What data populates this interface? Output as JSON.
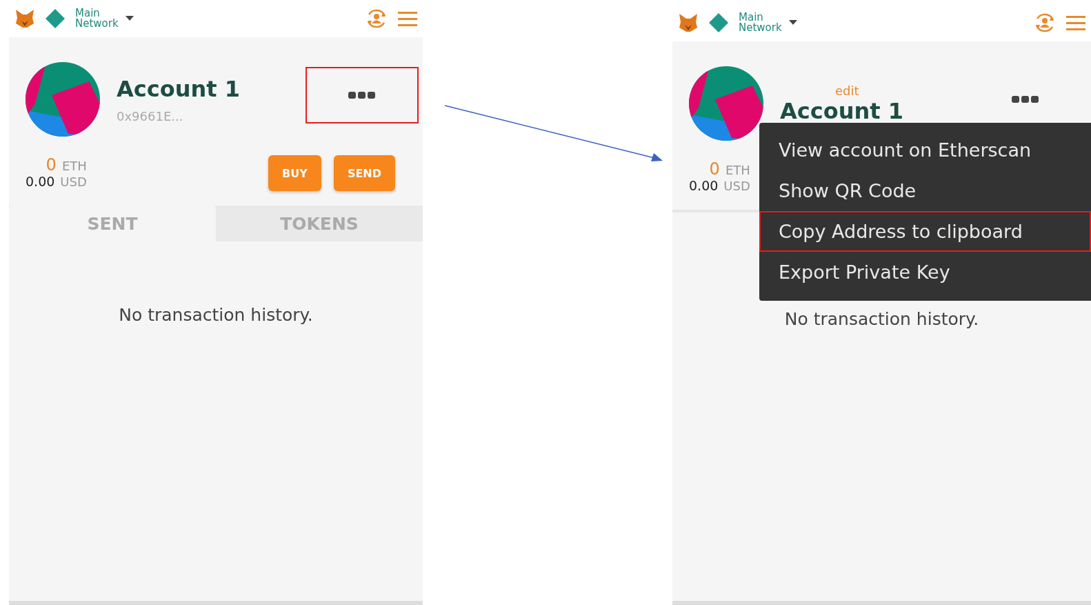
{
  "panels": [
    {
      "network": {
        "line1": "Main",
        "line2": "Network"
      },
      "account": {
        "name": "Account 1",
        "address": "0x9661E...",
        "options_highlighted": true
      },
      "balance": {
        "eth_amount": "0",
        "eth_unit": "ETH",
        "usd_amount": "0.00",
        "usd_unit": "USD"
      },
      "buttons": [
        "BUY",
        "SEND"
      ],
      "tabs": [
        {
          "label": "SENT",
          "selected": true
        },
        {
          "label": "TOKENS",
          "selected": false
        }
      ],
      "empty_message": "No transaction history."
    },
    {
      "network": {
        "line1": "Main",
        "line2": "Network"
      },
      "account": {
        "edit": "edit",
        "name": "Account 1",
        "options_highlighted": false
      },
      "balance": {
        "eth_amount": "0",
        "eth_unit": "ETH",
        "usd_amount": "0.00",
        "usd_unit": "USD"
      },
      "empty_message": "No transaction history.",
      "menu": [
        {
          "label": "View account on Etherscan",
          "highlighted": false
        },
        {
          "label": "Show QR Code",
          "highlighted": false
        },
        {
          "label": "Copy Address to clipboard",
          "highlighted": true
        },
        {
          "label": "Export Private Key",
          "highlighted": false
        }
      ]
    }
  ]
}
